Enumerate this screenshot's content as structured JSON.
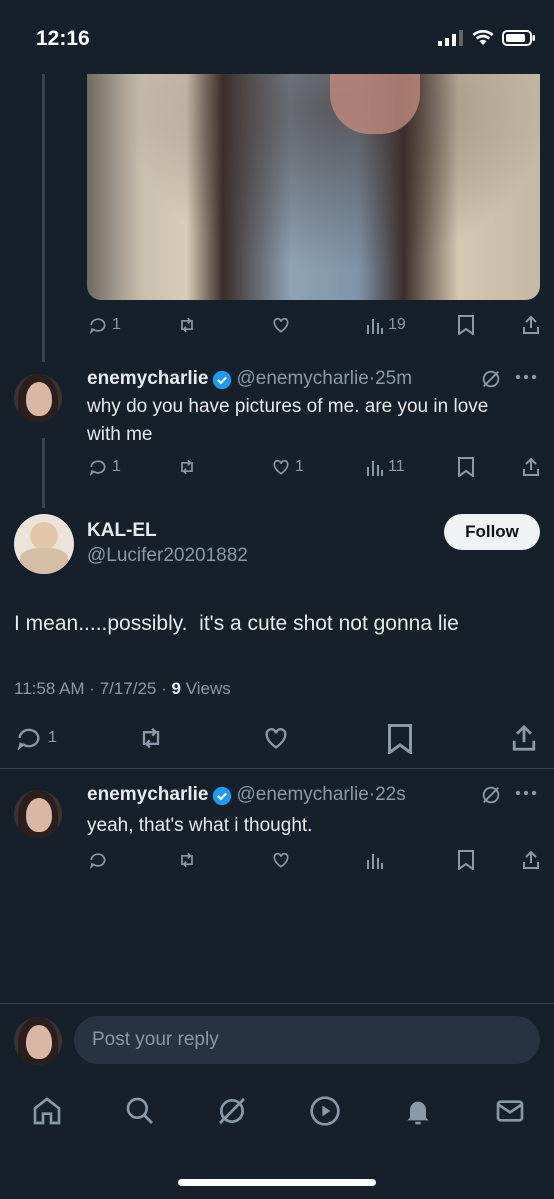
{
  "status_bar": {
    "time": "12:16"
  },
  "media_post": {
    "stats": {
      "replies": "1",
      "views": "19"
    }
  },
  "reply1": {
    "name": "enemycharlie",
    "handle": "@enemycharlie",
    "time": "25m",
    "text": "why do you have pictures of me. are you in love with me",
    "stats": {
      "replies": "1",
      "likes": "1",
      "views": "11"
    }
  },
  "main_tweet": {
    "name": "KAL-EL",
    "handle": "@Lucifer20201882",
    "follow_label": "Follow",
    "text": "I mean.....possibly.  it's a cute shot not gonna lie",
    "timestamp": "11:58 AM · 7/17/25 · ",
    "views_count": "9",
    "views_label": " Views",
    "stats": {
      "replies": "1"
    }
  },
  "reply2": {
    "name": "enemycharlie",
    "handle": "@enemycharlie",
    "time": "22s",
    "text": "yeah, that's what i thought."
  },
  "composer": {
    "placeholder": "Post your reply"
  },
  "colors": {
    "background": "#15202b",
    "verified": "#1d9bf0",
    "muted": "#8b98a5"
  },
  "nav": [
    "home-icon",
    "search-icon",
    "grok-icon",
    "video-icon",
    "notifications-icon",
    "messages-icon"
  ]
}
